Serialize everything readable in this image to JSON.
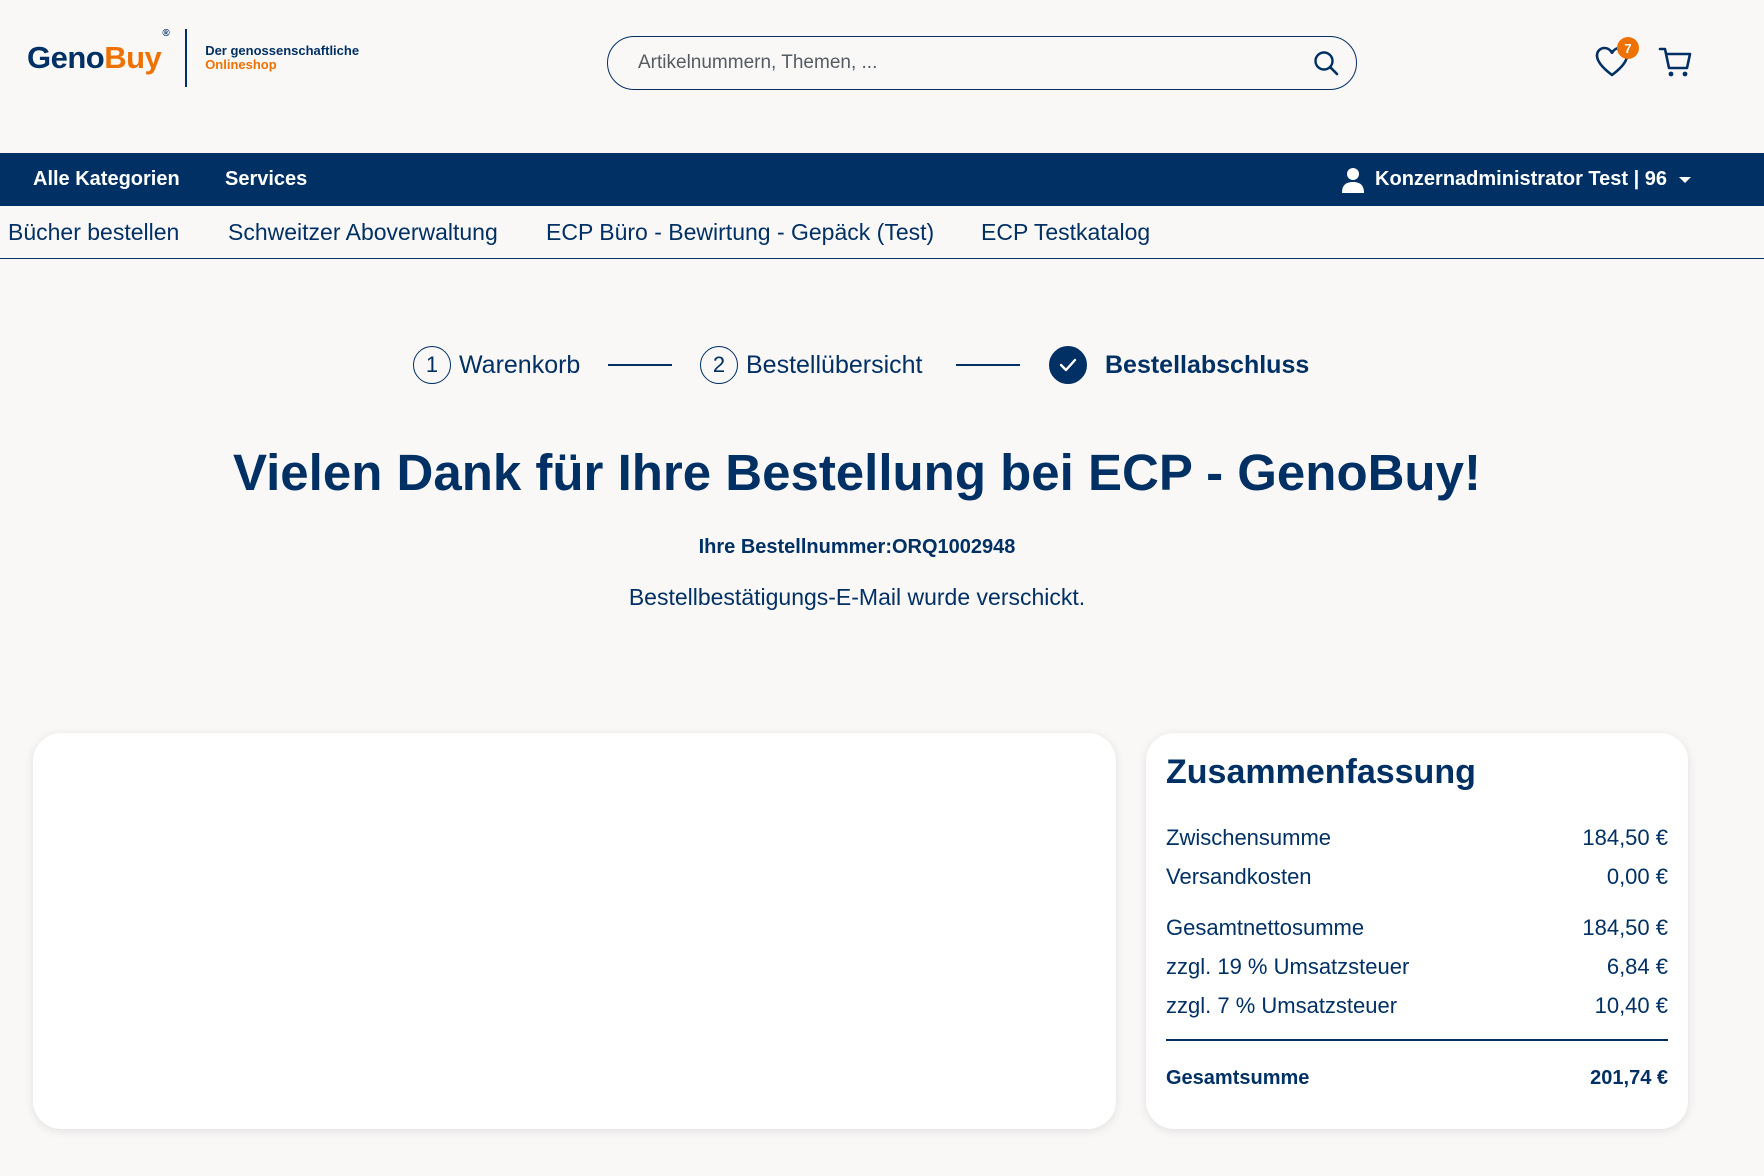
{
  "header": {
    "logo": {
      "geno": "Geno",
      "buy": "Buy",
      "reg": "®",
      "tagline_1": "Der genossenschaftliche",
      "tagline_2": "Onlineshop"
    },
    "search": {
      "placeholder": "Artikelnummern, Themen, ..."
    },
    "wishlist_count": "7"
  },
  "mainnav": {
    "items": [
      "Alle Kategorien",
      "Services"
    ],
    "user_label": "Konzernadministrator Test | 96"
  },
  "subnav": {
    "items": [
      "Bücher bestellen",
      "Schweitzer Aboverwaltung",
      "ECP Büro - Bewirtung - Gepäck (Test)",
      "ECP Testkatalog"
    ]
  },
  "stepper": {
    "steps": [
      {
        "number": "1",
        "label": "Warenkorb"
      },
      {
        "number": "2",
        "label": "Bestellübersicht"
      },
      {
        "number": "",
        "label": "Bestellabschluss"
      }
    ]
  },
  "confirmation": {
    "title": "Vielen Dank für Ihre Bestellung bei ECP - GenoBuy!",
    "order_number": "Ihre Bestellnummer:ORQ1002948",
    "mail_text": "Bestellbestätigungs-E-Mail wurde verschickt."
  },
  "summary": {
    "title": "Zusammenfassung",
    "rows": [
      {
        "label": "Zwischensumme",
        "value": "184,50 €"
      },
      {
        "label": "Versandkosten",
        "value": "0,00 €"
      },
      {
        "label": "Gesamtnettosumme",
        "value": "184,50 €"
      },
      {
        "label": "zzgl. 19 % Umsatzsteuer",
        "value": "6,84 €"
      },
      {
        "label": "zzgl. 7 % Umsatzsteuer",
        "value": "10,40 €"
      }
    ],
    "total": {
      "label": "Gesamtsumme",
      "value": "201,74 €"
    }
  },
  "colors": {
    "primary": "#003064",
    "accent": "#ee7203",
    "background": "#f9f8f7"
  }
}
